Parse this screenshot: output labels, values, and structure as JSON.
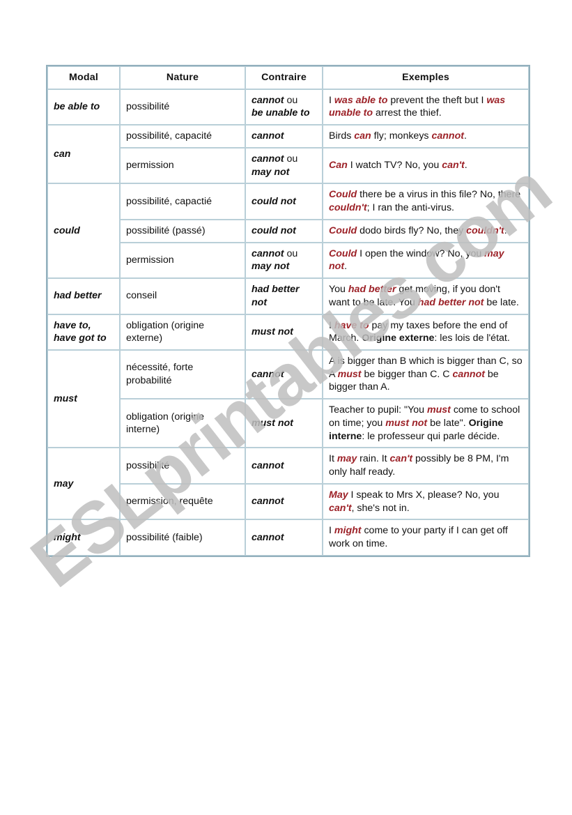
{
  "document": {
    "title": "Modals reference table",
    "watermark": "ESLprintables.com",
    "accent_red": "#9c2127",
    "border_color": "#b9cfd8",
    "text_color": "#141414"
  },
  "table": {
    "columns": [
      {
        "key": "modal",
        "label": "Modal"
      },
      {
        "key": "nature",
        "label": "Nature"
      },
      {
        "key": "contraire",
        "label": "Contraire"
      },
      {
        "key": "exemples",
        "label": "Exemples"
      }
    ],
    "groups": [
      {
        "modal": "be able to",
        "rows": [
          {
            "nature": "possibilité",
            "contraire_lines": [
              [
                {
                  "t": "cannot",
                  "s": "em"
                },
                {
                  "t": " ou",
                  "s": "plain"
                }
              ],
              [
                {
                  "t": "be unable to",
                  "s": "em"
                }
              ]
            ],
            "exemple": [
              {
                "t": "I ",
                "s": "plain"
              },
              {
                "t": "was able to",
                "s": "em"
              },
              {
                "t": " prevent the theft but I ",
                "s": "plain"
              },
              {
                "t": "was unable to",
                "s": "em"
              },
              {
                "t": " arrest the thief.",
                "s": "plain"
              }
            ]
          }
        ]
      },
      {
        "modal": "can",
        "rows": [
          {
            "nature": "possibilité, capacité",
            "contraire_lines": [
              [
                {
                  "t": "cannot",
                  "s": "em"
                }
              ]
            ],
            "exemple": [
              {
                "t": "Birds ",
                "s": "plain"
              },
              {
                "t": "can",
                "s": "em"
              },
              {
                "t": " fly; monkeys ",
                "s": "plain"
              },
              {
                "t": "cannot",
                "s": "em"
              },
              {
                "t": ".",
                "s": "plain"
              }
            ]
          },
          {
            "nature": "permission",
            "contraire_lines": [
              [
                {
                  "t": "cannot",
                  "s": "em"
                },
                {
                  "t": " ou",
                  "s": "plain"
                }
              ],
              [
                {
                  "t": "may not",
                  "s": "em"
                }
              ]
            ],
            "exemple": [
              {
                "t": "Can",
                "s": "em"
              },
              {
                "t": " I watch TV? No, you ",
                "s": "plain"
              },
              {
                "t": "can't",
                "s": "em"
              },
              {
                "t": ".",
                "s": "plain"
              }
            ]
          }
        ]
      },
      {
        "modal": "could",
        "rows": [
          {
            "nature": "possibilité, capactié",
            "contraire_lines": [
              [
                {
                  "t": "could not",
                  "s": "em"
                }
              ]
            ],
            "exemple": [
              {
                "t": "Could",
                "s": "em"
              },
              {
                "t": " there be a virus in this file? No, there ",
                "s": "plain"
              },
              {
                "t": "couldn't",
                "s": "em"
              },
              {
                "t": "; I ran the anti-virus.",
                "s": "plain"
              }
            ]
          },
          {
            "nature": "possibilité (passé)",
            "contraire_lines": [
              [
                {
                  "t": "could not",
                  "s": "em"
                }
              ]
            ],
            "exemple": [
              {
                "t": "Could",
                "s": "em"
              },
              {
                "t": " dodo birds fly? No, they ",
                "s": "plain"
              },
              {
                "t": "couldn't",
                "s": "em"
              },
              {
                "t": ".",
                "s": "plain"
              }
            ]
          },
          {
            "nature": "permission",
            "contraire_lines": [
              [
                {
                  "t": "cannot",
                  "s": "em"
                },
                {
                  "t": " ou",
                  "s": "plain"
                }
              ],
              [
                {
                  "t": "may not",
                  "s": "em"
                }
              ]
            ],
            "exemple": [
              {
                "t": "Could",
                "s": "em"
              },
              {
                "t": " I open the window? No, you ",
                "s": "plain"
              },
              {
                "t": "may not",
                "s": "em"
              },
              {
                "t": ".",
                "s": "plain"
              }
            ]
          }
        ]
      },
      {
        "modal": "had better",
        "rows": [
          {
            "nature": "conseil",
            "contraire_lines": [
              [
                {
                  "t": "had better not",
                  "s": "em"
                }
              ]
            ],
            "exemple": [
              {
                "t": "You ",
                "s": "plain"
              },
              {
                "t": "had better",
                "s": "em"
              },
              {
                "t": " get moving, if you don't want to be late. You ",
                "s": "plain"
              },
              {
                "t": "had better not",
                "s": "em"
              },
              {
                "t": " be late.",
                "s": "plain"
              }
            ]
          }
        ]
      },
      {
        "modal": "have to, have got to",
        "rows": [
          {
            "nature": "obligation (origine externe)",
            "contraire_lines": [
              [
                {
                  "t": "must not",
                  "s": "em"
                }
              ]
            ],
            "exemple": [
              {
                "t": "I ",
                "s": "plain"
              },
              {
                "t": "have to",
                "s": "em"
              },
              {
                "t": " pay my taxes before the end of March. ",
                "s": "plain"
              },
              {
                "t": "Origine externe",
                "s": "strong"
              },
              {
                "t": ": les lois de l'état.",
                "s": "plain"
              }
            ]
          }
        ]
      },
      {
        "modal": "must",
        "rows": [
          {
            "nature": "nécessité, forte probabilité",
            "contraire_lines": [
              [
                {
                  "t": "cannot",
                  "s": "em"
                }
              ]
            ],
            "exemple": [
              {
                "t": "A is bigger than B which is bigger than C, so A ",
                "s": "plain"
              },
              {
                "t": "must",
                "s": "em"
              },
              {
                "t": " be bigger than C. C ",
                "s": "plain"
              },
              {
                "t": "cannot",
                "s": "em"
              },
              {
                "t": " be bigger than A.",
                "s": "plain"
              }
            ]
          },
          {
            "nature": "obligation (origine interne)",
            "contraire_lines": [
              [
                {
                  "t": "must not",
                  "s": "em"
                }
              ]
            ],
            "exemple": [
              {
                "t": "Teacher to pupil: \"You ",
                "s": "plain"
              },
              {
                "t": "must",
                "s": "em"
              },
              {
                "t": " come to school on time; you ",
                "s": "plain"
              },
              {
                "t": "must not",
                "s": "em"
              },
              {
                "t": " be late\". ",
                "s": "plain"
              },
              {
                "t": "Origine interne",
                "s": "strong"
              },
              {
                "t": ": le professeur qui parle décide.",
                "s": "plain"
              }
            ]
          }
        ]
      },
      {
        "modal": "may",
        "rows": [
          {
            "nature": "possibilité",
            "contraire_lines": [
              [
                {
                  "t": "cannot",
                  "s": "em"
                }
              ]
            ],
            "exemple": [
              {
                "t": "It ",
                "s": "plain"
              },
              {
                "t": "may",
                "s": "em"
              },
              {
                "t": " rain. It ",
                "s": "plain"
              },
              {
                "t": "can't",
                "s": "em"
              },
              {
                "t": " possibly be 8 PM, I'm only half ready.",
                "s": "plain"
              }
            ]
          },
          {
            "nature": "permission, requête",
            "contraire_lines": [
              [
                {
                  "t": "cannot",
                  "s": "em"
                }
              ]
            ],
            "exemple": [
              {
                "t": "May",
                "s": "em"
              },
              {
                "t": " I speak to Mrs X, please? No, you ",
                "s": "plain"
              },
              {
                "t": "can't",
                "s": "em"
              },
              {
                "t": ", she's not in.",
                "s": "plain"
              }
            ]
          }
        ]
      },
      {
        "modal": "might",
        "rows": [
          {
            "nature": "possibilité (faible)",
            "contraire_lines": [
              [
                {
                  "t": "cannot",
                  "s": "em"
                }
              ]
            ],
            "exemple": [
              {
                "t": "I ",
                "s": "plain"
              },
              {
                "t": "might",
                "s": "em"
              },
              {
                "t": " come to your party if I can get off work on time.",
                "s": "plain"
              }
            ]
          }
        ]
      }
    ]
  }
}
